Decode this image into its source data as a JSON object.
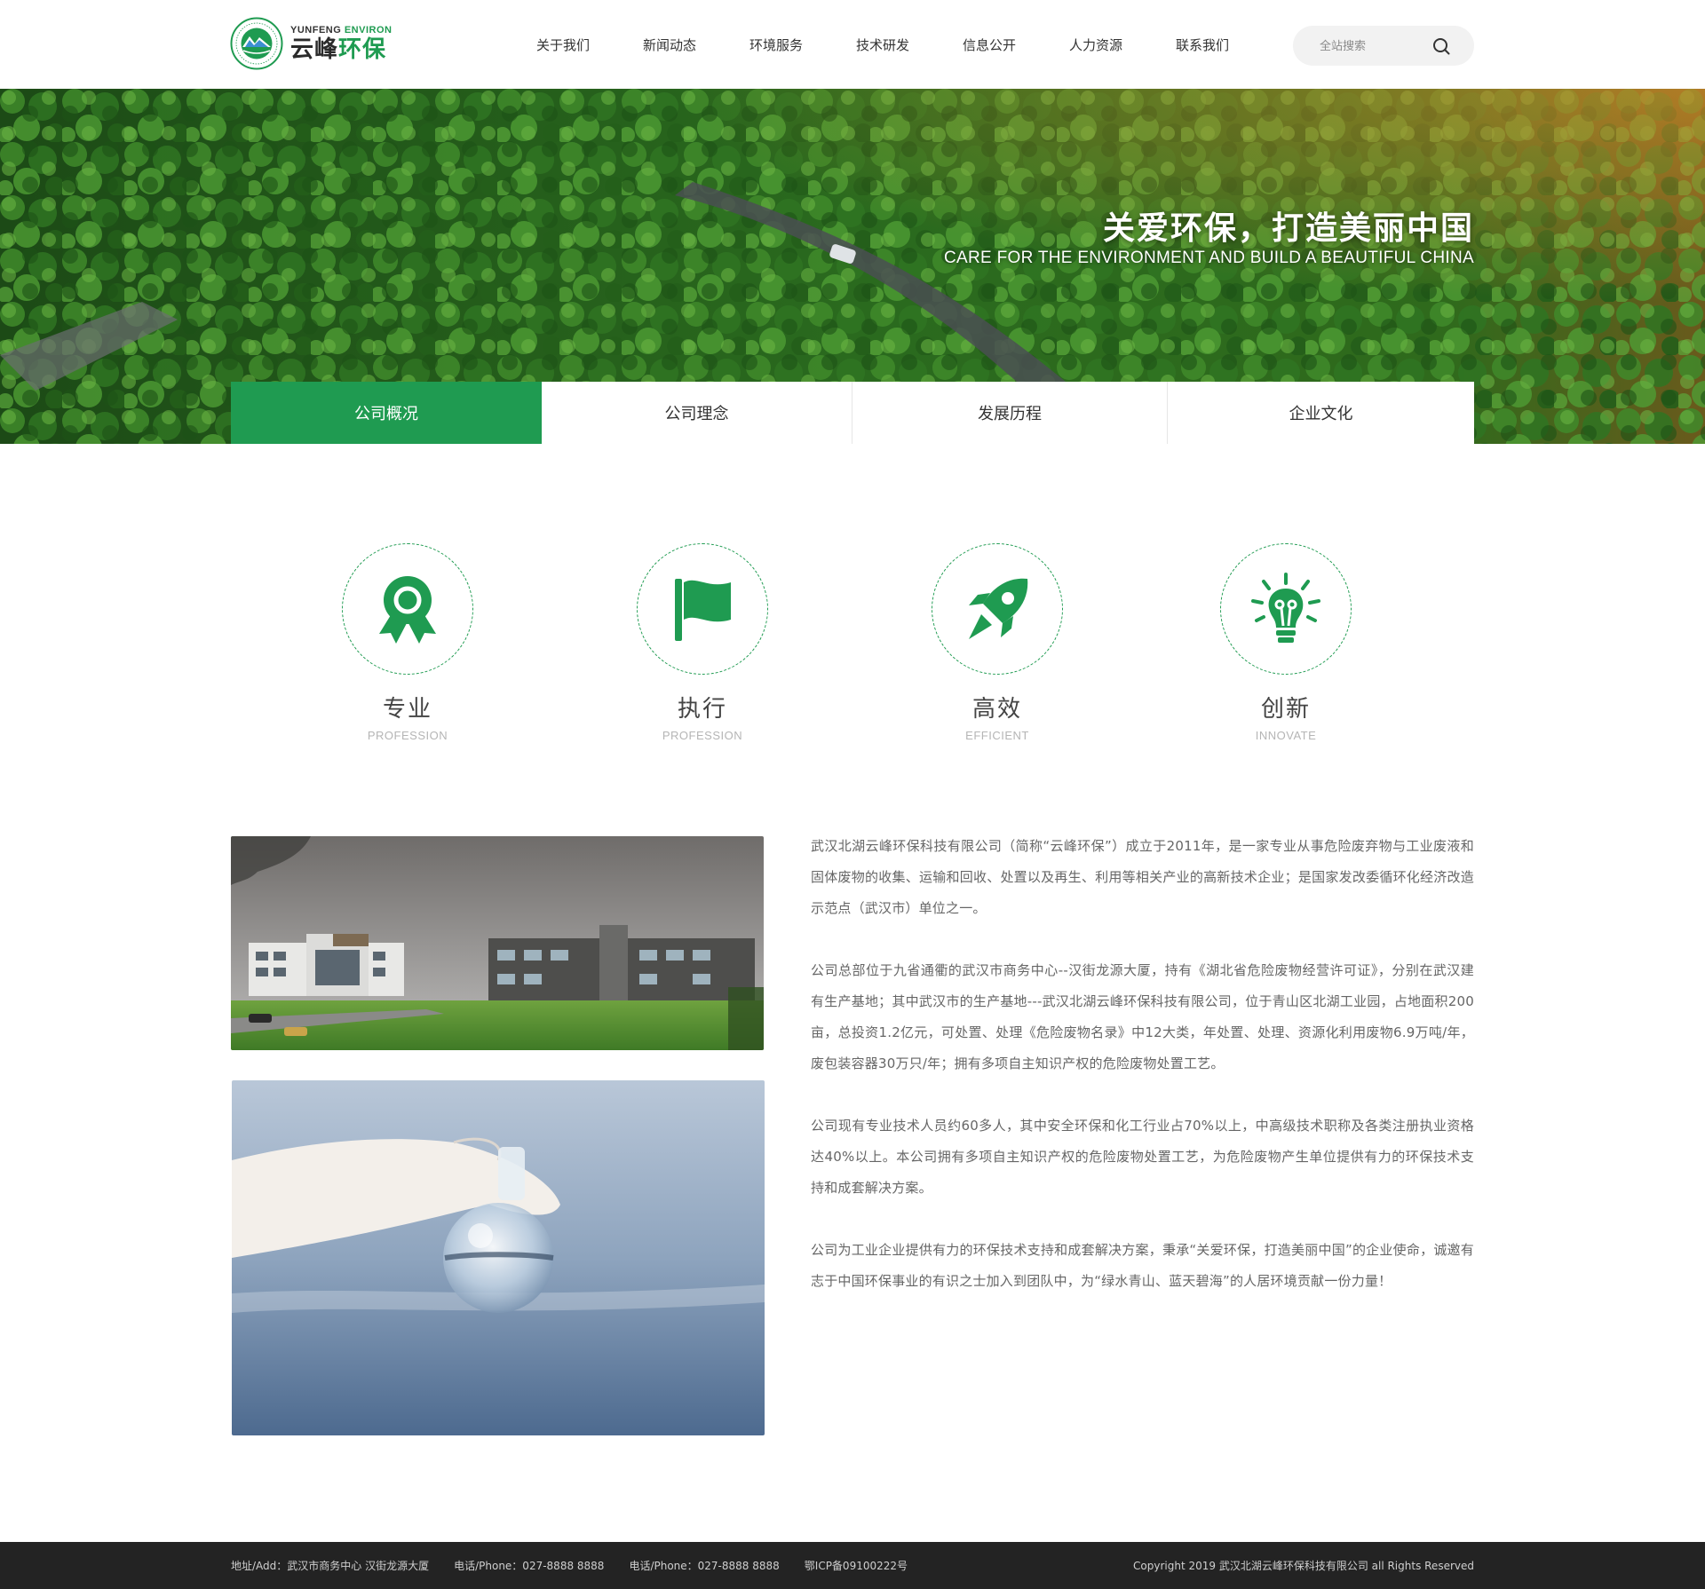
{
  "brand": {
    "en_word1": "YUNFENG",
    "en_word2": "ENVIRON",
    "cn_word1": "云峰",
    "cn_word2": "环保",
    "primary_color": "#1f9b51"
  },
  "nav": {
    "items": [
      {
        "label": "关于我们"
      },
      {
        "label": "新闻动态"
      },
      {
        "label": "环境服务"
      },
      {
        "label": "技术研发"
      },
      {
        "label": "信息公开"
      },
      {
        "label": "人力资源"
      },
      {
        "label": "联系我们"
      }
    ]
  },
  "search": {
    "placeholder": "全站搜索",
    "value": "",
    "icon": "search-icon"
  },
  "banner": {
    "title": "关爱环保，打造美丽中国",
    "subtitle": "CARE FOR THE ENVIRONMENT AND BUILD A BEAUTIFUL CHINA"
  },
  "tabs": [
    {
      "label": "公司概况",
      "active": true
    },
    {
      "label": "公司理念",
      "active": false
    },
    {
      "label": "发展历程",
      "active": false
    },
    {
      "label": "企业文化",
      "active": false
    }
  ],
  "values": [
    {
      "title": "专业",
      "subtitle": "PROFESSION",
      "icon": "award-ribbon-icon"
    },
    {
      "title": "执行",
      "subtitle": "PROFESSION",
      "icon": "flag-icon"
    },
    {
      "title": "高效",
      "subtitle": "EFFICIENT",
      "icon": "rocket-icon"
    },
    {
      "title": "创新",
      "subtitle": "INNOVATE",
      "icon": "lightbulb-icon"
    }
  ],
  "about": {
    "paragraphs": [
      "武汉北湖云峰环保科技有限公司（简称“云峰环保”）成立于2011年，是一家专业从事危险废弃物与工业废液和固体废物的收集、运输和回收、处置以及再生、利用等相关产业的高新技术企业；是国家发改委循环化经济改造示范点（武汉市）单位之一。",
      "公司总部位于九省通衢的武汉市商务中心--汉街龙源大厦，持有《湖北省危险废物经营许可证》，分别在武汉建有生产基地；其中武汉市的生产基地---武汉北湖云峰环保科技有限公司，位于青山区北湖工业园，占地面积200亩，总投资1.2亿元，可处置、处理《危险废物名录》中12大类，年处置、处理、资源化利用废物6.9万吨/年，废包装容器30万只/年；拥有多项自主知识产权的危险废物处置工艺。",
      "公司现有专业技术人员约60多人，其中安全环保和化工行业占70%以上，中高级技术职称及各类注册执业资格达40%以上。本公司拥有多项自主知识产权的危险废物处置工艺，为危险废物产生单位提供有力的环保技术支持和成套解决方案。",
      "公司为工业企业提供有力的环保技术支持和成套解决方案，秉承“关爱环保，打造美丽中国”的企业使命，诚邀有志于中国环保事业的有识之士加入到团队中，为“绿水青山、蓝天碧海”的人居环境贡献一份力量！"
    ]
  },
  "footer": {
    "address": "地址/Add：武汉市商务中心 汉街龙源大厦",
    "phone1": "电话/Phone：027-8888 8888",
    "phone2": "电话/Phone：027-8888 8888",
    "icp": "鄂ICP备09100222号",
    "copyright": "Copyright 2019 武汉北湖云峰环保科技有限公司 all Rights Reserved"
  }
}
